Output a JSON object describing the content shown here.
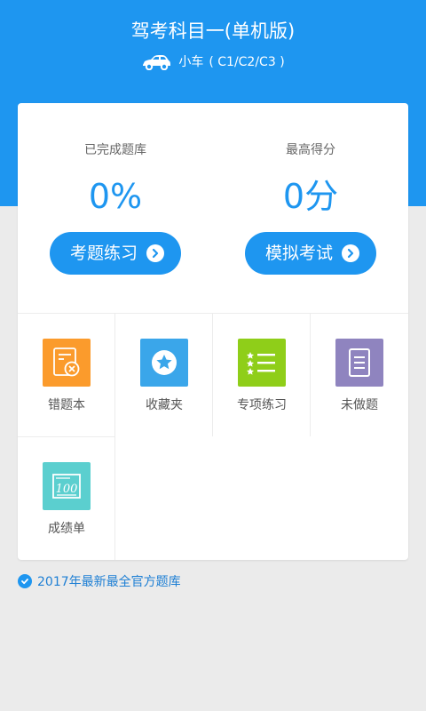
{
  "header": {
    "title": "驾考科目一(单机版)",
    "vehicle_label": "小车",
    "license_types": "( C1/C2/C3 )"
  },
  "stats": {
    "completed": {
      "label": "已完成题库",
      "value": "0%",
      "button": "考题练习"
    },
    "best_score": {
      "label": "最高得分",
      "value": "0分",
      "button": "模拟考试"
    }
  },
  "menu": [
    {
      "label": "错题本",
      "color": "#fb9b2c",
      "icon": "wrong-book-icon"
    },
    {
      "label": "收藏夹",
      "color": "#3aa6ea",
      "icon": "star-icon"
    },
    {
      "label": "专项练习",
      "color": "#8fce19",
      "icon": "list-icon"
    },
    {
      "label": "未做题",
      "color": "#8f84bf",
      "icon": "document-icon"
    },
    {
      "label": "成绩单",
      "color": "#5bcfcf",
      "icon": "score-icon"
    }
  ],
  "footer": {
    "note": "2017年最新最全官方题库"
  },
  "colors": {
    "primary": "#1e96f0"
  }
}
